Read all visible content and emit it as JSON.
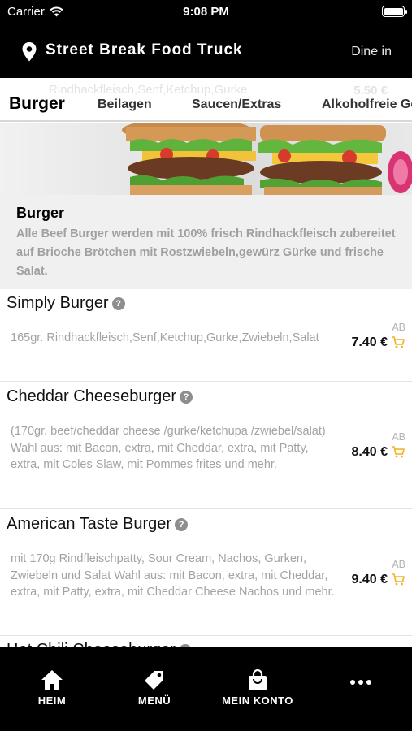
{
  "status_bar": {
    "carrier": "Carrier",
    "time": "9:08 PM"
  },
  "header": {
    "title": "Street Break Food Truck",
    "mode": "Dine in"
  },
  "tabs": {
    "ghost_text": "Rindhackfleisch,Senf,Ketchup,Gurke",
    "ghost_price": "5.50 €",
    "items": [
      {
        "label": "Burger",
        "active": true
      },
      {
        "label": "Beilagen"
      },
      {
        "label": "Saucen/Extras"
      },
      {
        "label": "Alkoholfreie Ge"
      }
    ]
  },
  "category": {
    "title": "Burger",
    "description": "Alle Beef Burger werden mit 100% frisch Rindhackfleisch zubereitet auf Brioche Brötchen mit Rostzwiebeln,gewürz Gürke und frische Salat."
  },
  "products": [
    {
      "name": "Simply Burger",
      "description": "165gr. Rindhackfleisch,Senf,Ketchup,Gurke,Zwiebeln,Salat",
      "tag": "AB",
      "price": "7.40 €"
    },
    {
      "name": "Cheddar Cheeseburger",
      "description": "(170gr. beef/cheddar cheese /gurke/ketchupa /zwiebel/salat) Wahl aus: mit Bacon, extra, mit Cheddar, extra, mit Patty, extra, mit Coles Slaw, mit Pommes frites und mehr.",
      "tag": "AB",
      "price": "8.40 €"
    },
    {
      "name": "American Taste Burger",
      "description": "mit 170g Rindfleischpatty, Sour Cream, Nachos, Gurken, Zwiebeln und Salat Wahl aus: mit Bacon, extra, mit Cheddar, extra, mit Patty, extra, mit Cheddar Cheese Nachos und mehr.",
      "tag": "AB",
      "price": "9.40 €"
    },
    {
      "name": "Hot Chili Cheeseburger"
    }
  ],
  "bottom_nav": [
    {
      "label": "HEIM",
      "icon": "home-icon"
    },
    {
      "label": "MENÜ",
      "icon": "tag-icon"
    },
    {
      "label": "MEIN KONTO",
      "icon": "shopping-bag-icon"
    },
    {
      "label": "",
      "icon": "more-icon"
    }
  ],
  "colors": {
    "accent": "#f2b21b",
    "header_bg": "#000000",
    "muted_text": "#a3a3a3"
  }
}
